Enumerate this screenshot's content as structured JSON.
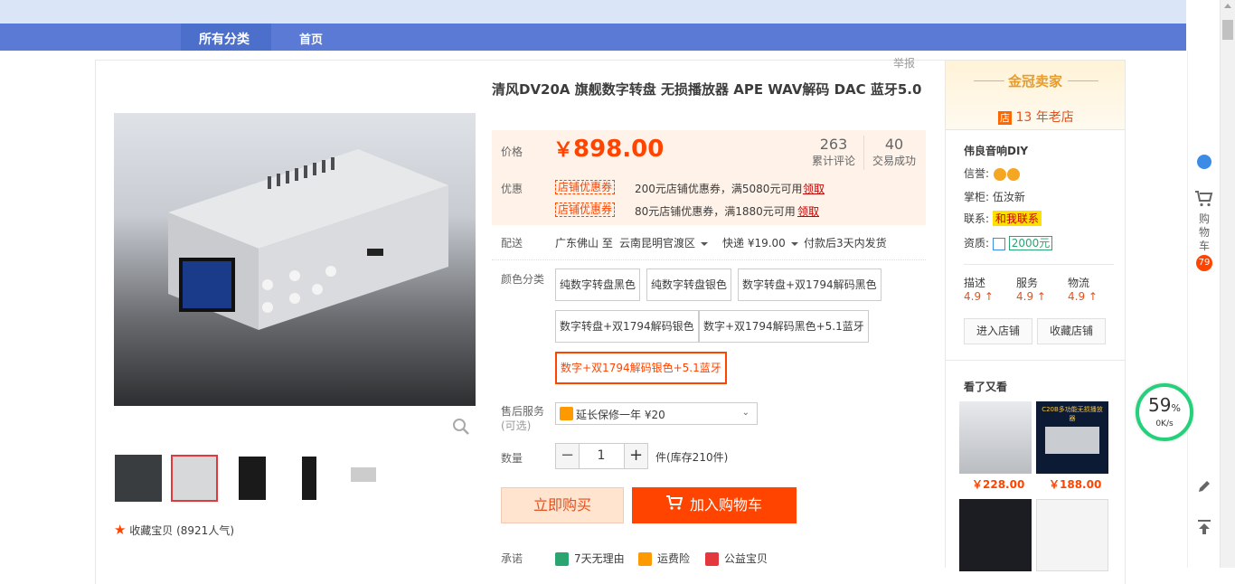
{
  "nav": {
    "all_categories": "所有分类",
    "home": "首页"
  },
  "report": "举报",
  "product": {
    "title": "清风DV20A 旗舰数字转盘 无损播放器 APE WAV解码 DAC 蓝牙5.0",
    "price_label": "价格",
    "currency": "￥",
    "price": "898.00",
    "reviews_count": "263",
    "reviews_label": "累计评论",
    "deals_count": "40",
    "deals_label": "交易成功",
    "promo_label": "优惠",
    "coupons": [
      {
        "tag": "店铺优惠券",
        "text": "200元店铺优惠券，满5080元可用",
        "action": "领取"
      },
      {
        "tag": "店铺优惠券",
        "text": "80元店铺优惠券，满1880元可用",
        "action": "领取"
      }
    ],
    "shipping_label": "配送",
    "ship_from": "广东佛山 至",
    "ship_to": "云南昆明官渡区",
    "ship_method": "快递 ¥19.00",
    "ship_time": "付款后3天内发货",
    "color_label": "颜色分类",
    "skus": [
      "纯数字转盘黑色",
      "纯数字转盘银色",
      "数字转盘+双1794解码黑色",
      "数字转盘+双1794解码银色",
      "数字+双1794解码黑色+5.1蓝牙",
      "数字+双1794解码银色+5.1蓝牙"
    ],
    "selected_sku": "数字+双1794解码银色+5.1蓝牙",
    "service_label": "售后服务",
    "service_sub": "(可选)",
    "service_option": "延长保修一年 ¥20",
    "qty_label": "数量",
    "qty_value": "1",
    "stock": "件(库存210件)",
    "buy_now": "立即购买",
    "add_cart": "加入购物车",
    "promise_label": "承诺",
    "promises": [
      "7天无理由",
      "运费险",
      "公益宝贝"
    ],
    "favorite": "收藏宝贝 (8921人气)"
  },
  "shop": {
    "badge": "金冠卖家",
    "years": "13 年老店",
    "years_icon": "店",
    "name": "伟良音响DIY",
    "reputation_label": "信誉:",
    "keeper_label": "掌柜:",
    "keeper": "伍汝新",
    "contact_label": "联系:",
    "contact_btn": "和我联系",
    "qualification_label": "资质:",
    "deposit": "2000元",
    "scores": [
      {
        "label": "描述",
        "value": "4.9"
      },
      {
        "label": "服务",
        "value": "4.9"
      },
      {
        "label": "物流",
        "value": "4.9"
      }
    ],
    "enter_shop": "进入店铺",
    "fav_shop": "收藏店铺",
    "see_also": "看了又看",
    "recs": [
      {
        "price": "￥228.00"
      },
      {
        "price": "￥188.00"
      }
    ],
    "rec_img_text": "C20B多功能无损播放器"
  },
  "rail": {
    "cart_label": "购物车",
    "cart_count": "79"
  },
  "speed": {
    "percent": "59",
    "unit": "%",
    "rate": "0K/s"
  },
  "colors": {
    "accent": "#ff4400",
    "nav": "#5a7ad5",
    "price_bg": "#fff2e8",
    "crown": "#e79c2e"
  }
}
